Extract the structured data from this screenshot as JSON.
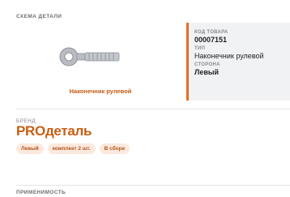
{
  "diagram": {
    "section_title": "СХЕМА ДЕТАЛИ",
    "caption": "Наконечник рулевой"
  },
  "info": {
    "code_label": "КОД ТОВАРА",
    "code_value": "00007151",
    "type_label": "ТИП",
    "type_value": "Наконечник рулевой",
    "side_label": "СТОРОНА",
    "side_value": "Левый"
  },
  "brand": {
    "label": "БРЕНД",
    "name": "PROдеталь"
  },
  "chips": [
    "Левый",
    "комплект 2 шт.",
    "В сборе"
  ],
  "applicability": {
    "section_title": "ПРИМЕНИМОСТЬ"
  },
  "colors": {
    "accent": "#c85e14",
    "chip_bg": "#fbe9dd",
    "panel_bg": "#f1f2f4"
  }
}
